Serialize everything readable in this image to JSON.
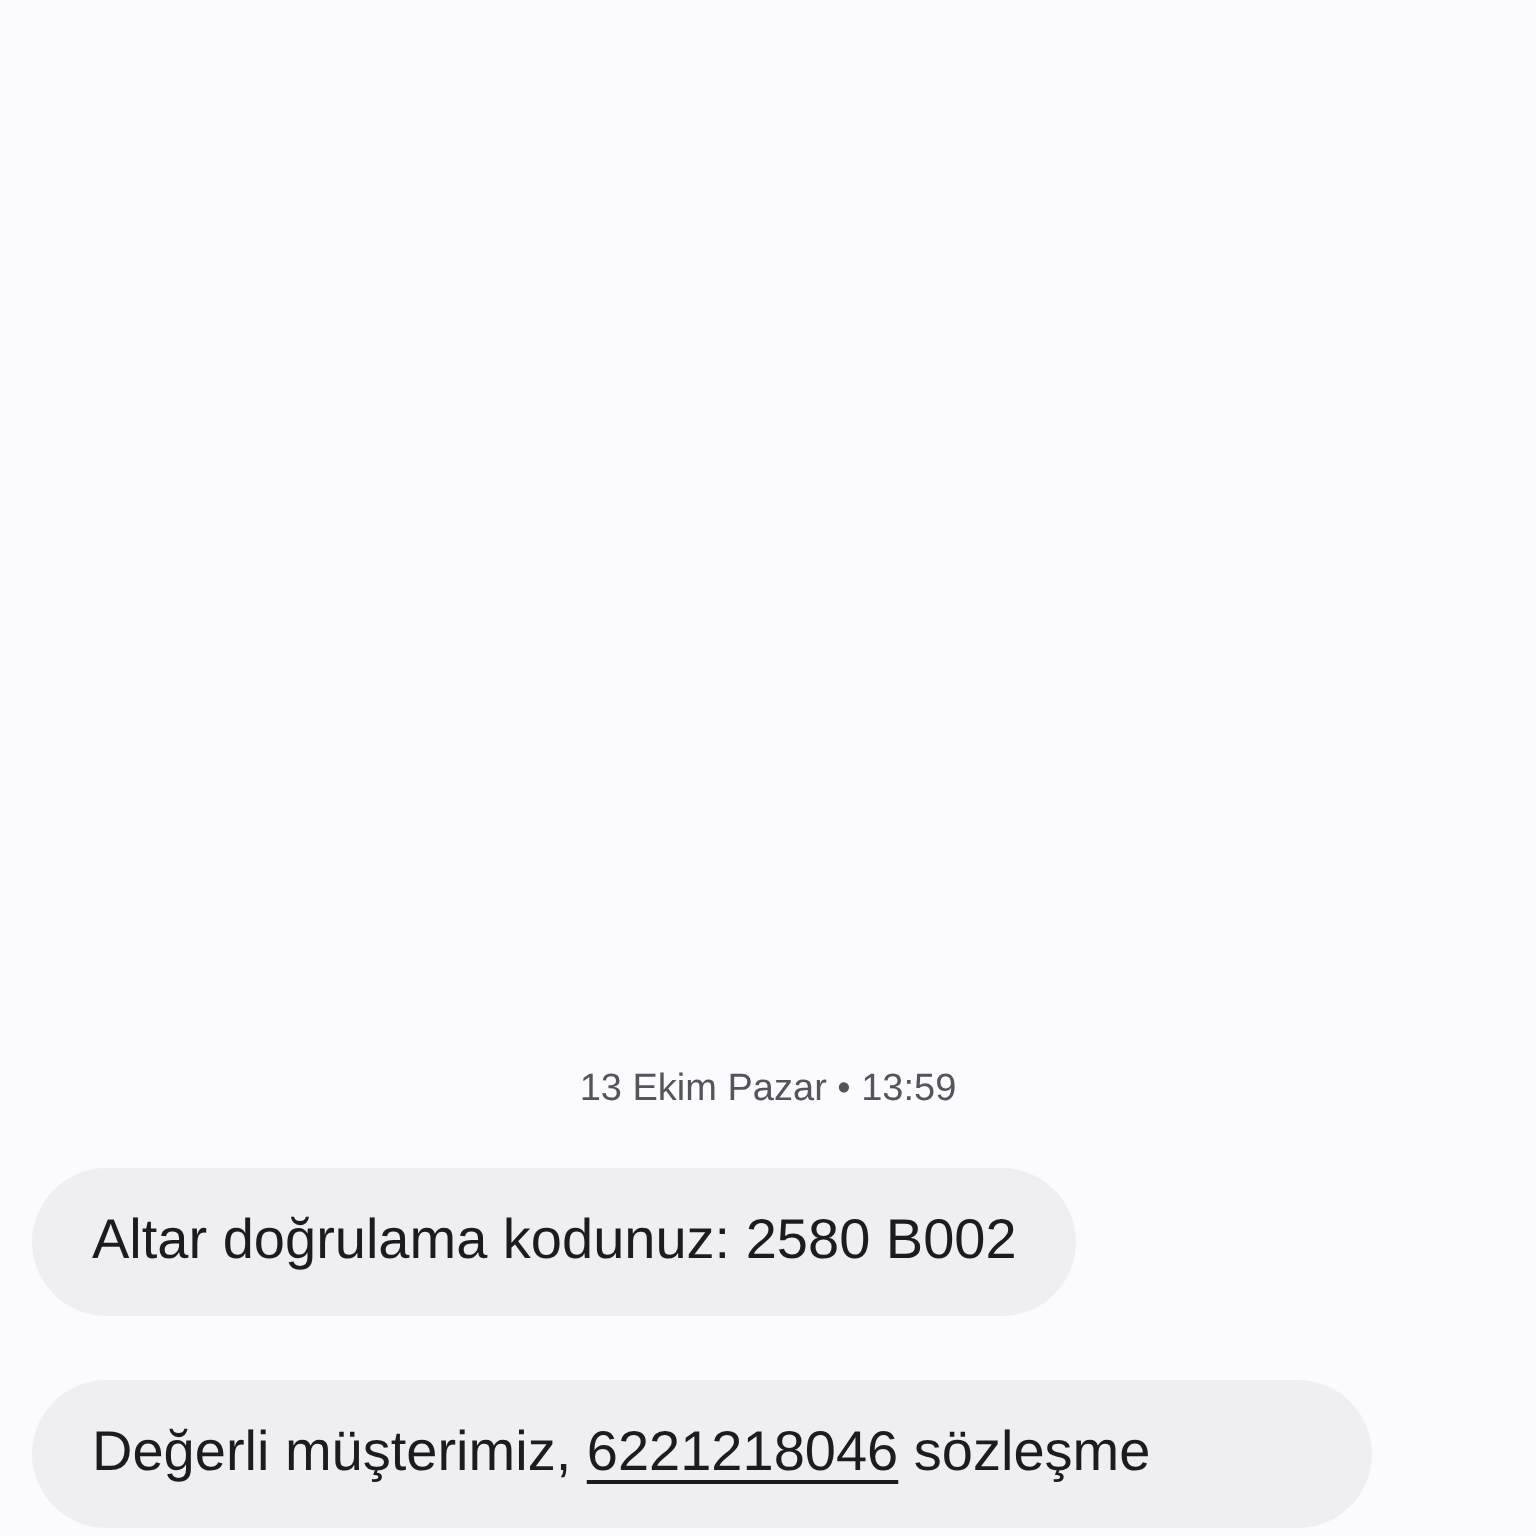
{
  "date_header": "13 Ekim Pazar • 13:59",
  "messages": [
    {
      "parts": [
        {
          "kind": "text",
          "text": "Altar doğrulama kodunuz: 2580 B002"
        }
      ]
    },
    {
      "parts": [
        {
          "kind": "text",
          "text": "Değerli müşterimiz, "
        },
        {
          "kind": "link",
          "text": "6221218046"
        },
        {
          "kind": "text",
          "text": " sözleşme"
        }
      ]
    }
  ]
}
